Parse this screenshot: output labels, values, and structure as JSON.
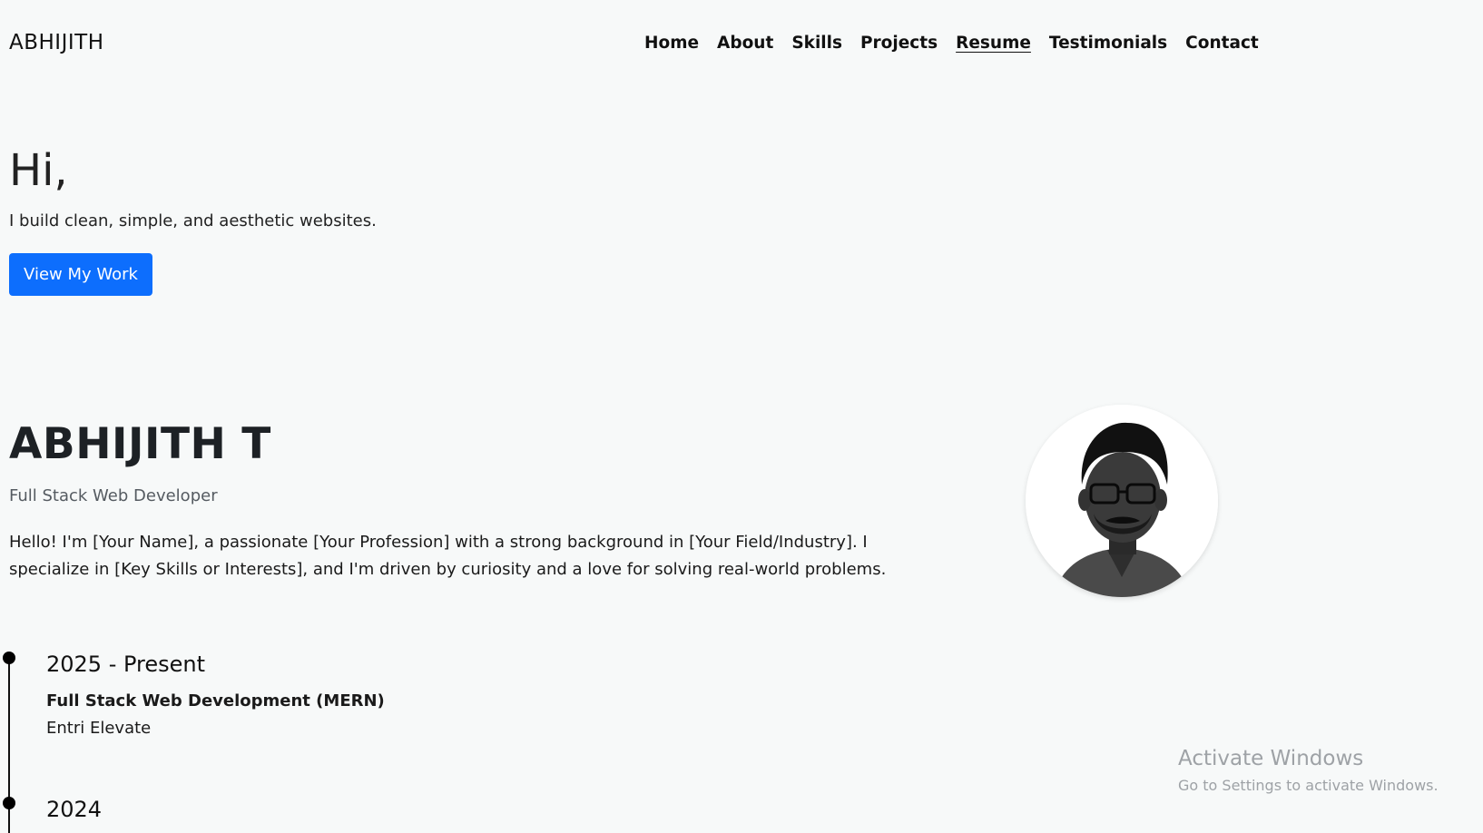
{
  "header": {
    "brand": "ABHIJITH",
    "nav": [
      {
        "label": "Home"
      },
      {
        "label": "About"
      },
      {
        "label": "Skills"
      },
      {
        "label": "Projects"
      },
      {
        "label": "Resume",
        "active": true
      },
      {
        "label": "Testimonials"
      },
      {
        "label": "Contact"
      }
    ]
  },
  "hero": {
    "greeting": "Hi,",
    "tagline": "I build clean, simple, and aesthetic websites.",
    "cta_label": "View My Work",
    "cta_color": "#0d6efd"
  },
  "about": {
    "name": "ABHIJITH T",
    "role": "Full Stack Web Developer",
    "bio": "Hello! I'm [Your Name], a passionate [Your Profession] with a strong background in [Your Field/Industry]. I specialize in [Key Skills or Interests], and I'm driven by curiosity and a love for solving real-world problems.",
    "avatar_alt": "profile photo"
  },
  "timeline": [
    {
      "year": "2025 - Present",
      "title": "Full Stack Web Development (MERN)",
      "org": "Entri Elevate"
    },
    {
      "year": "2024",
      "title": "",
      "org": ""
    }
  ],
  "watermark": {
    "title": "Activate Windows",
    "subtitle": "Go to Settings to activate Windows."
  }
}
